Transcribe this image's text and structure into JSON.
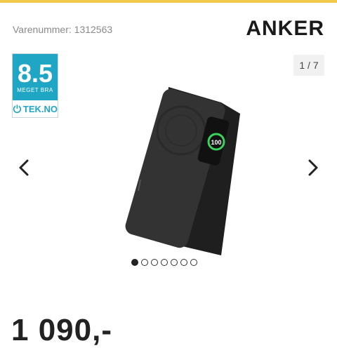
{
  "colors": {
    "top_accent": "#f2c94c",
    "rating_bg": "#1fa6c4",
    "rating_brand": "#1fa6c4"
  },
  "header": {
    "sku_label": "Varenummer: 1312563",
    "brand": "ANKER"
  },
  "rating": {
    "score": "8.5",
    "word": "MEGET BRA",
    "source": "TEK.NO",
    "icon": "power-icon"
  },
  "gallery": {
    "counter": "1 / 7",
    "prev_icon": "chevron-left-icon",
    "next_icon": "chevron-right-icon",
    "device_display": "100",
    "total_images": 7,
    "active_index": 0
  },
  "price": {
    "value": "1 090,-"
  }
}
